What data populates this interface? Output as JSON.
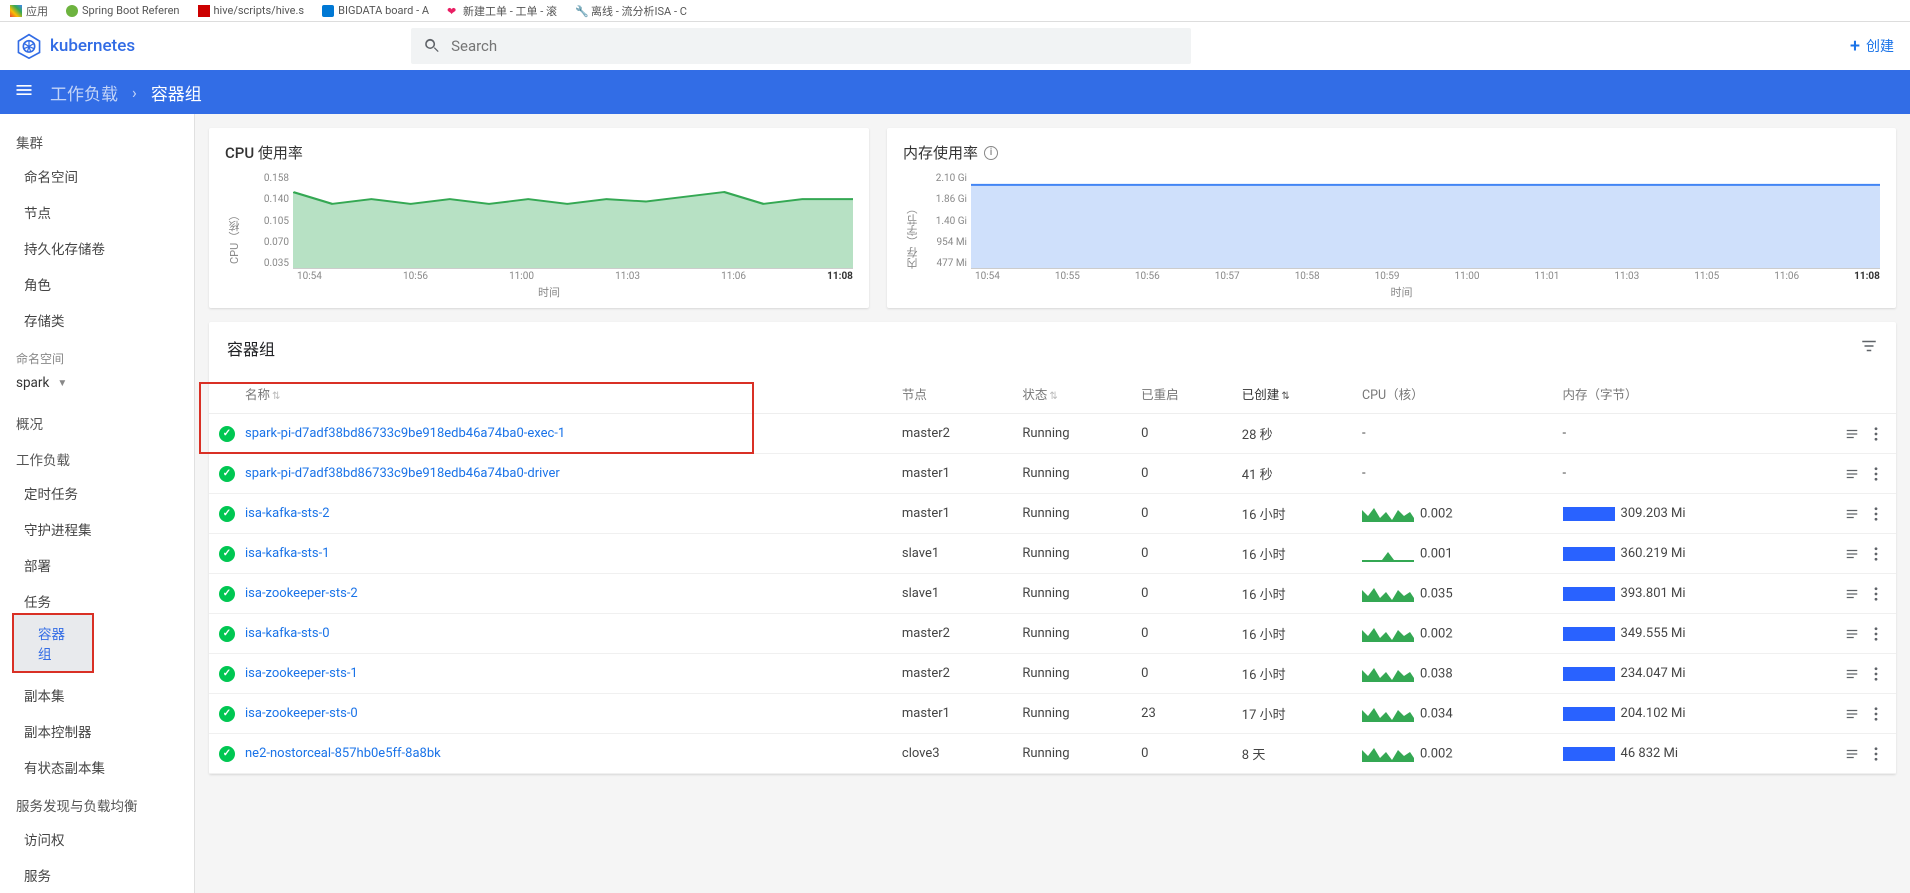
{
  "browser_tabs": [
    {
      "icon": "apps",
      "label": "应用"
    },
    {
      "icon": "spring",
      "label": "Spring Boot Referen"
    },
    {
      "icon": "hive",
      "label": "hive/scripts/hive.s"
    },
    {
      "icon": "az",
      "label": "BIGDATA board - A"
    },
    {
      "icon": "heart",
      "label": "新建工单 - 工单 - 滚"
    },
    {
      "icon": "tool",
      "label": "离线 - 流分析ISA - C"
    }
  ],
  "brand": "kubernetes",
  "search_placeholder": "Search",
  "create_label": "创建",
  "breadcrumb": {
    "a": "工作负载",
    "b": "容器组"
  },
  "sidebar": {
    "group_cluster": "集群",
    "cluster_items": [
      "命名空间",
      "节点",
      "持久化存储卷",
      "角色",
      "存储类"
    ],
    "ns_label": "命名空间",
    "ns_value": "spark",
    "group_overview": "概况",
    "group_workloads": "工作负载",
    "workload_items": [
      "定时任务",
      "守护进程集",
      "部署",
      "任务",
      "容器组",
      "副本集",
      "副本控制器",
      "有状态副本集"
    ],
    "active_workload_index": 4,
    "group_discovery": "服务发现与负载均衡",
    "discovery_items": [
      "访问权",
      "服务"
    ]
  },
  "cpu_card": {
    "title": "CPU 使用率",
    "ylabel": "CPU（核）",
    "xlabel": "时间"
  },
  "mem_card": {
    "title": "内存使用率",
    "ylabel": "内存（字节）",
    "xlabel": "时间"
  },
  "chart_data": [
    {
      "type": "area",
      "title": "CPU 使用率",
      "xlabel": "时间",
      "ylabel": "CPU（核）",
      "ylim": [
        0,
        0.158
      ],
      "yticks": [
        "0.158",
        "0.140",
        "0.105",
        "0.070",
        "0.035"
      ],
      "categories": [
        "10:54",
        "10:56",
        "11:00",
        "11:03",
        "11:06",
        "11:08"
      ],
      "values": [
        0.14,
        0.12,
        0.125,
        0.12,
        0.125,
        0.12,
        0.125,
        0.12,
        0.125,
        0.122,
        0.125,
        0.13,
        0.12,
        0.123,
        0.125
      ],
      "color": "#34a853",
      "fill": "#b7e1c4"
    },
    {
      "type": "area",
      "title": "内存使用率",
      "xlabel": "时间",
      "ylabel": "内存（字节）",
      "ylim": [
        0,
        2.1
      ],
      "yticks": [
        "2.10 Gi",
        "1.86 Gi",
        "1.40 Gi",
        "954 Mi",
        "477 Mi"
      ],
      "categories": [
        "10:54",
        "10:55",
        "10:56",
        "10:57",
        "10:58",
        "10:59",
        "11:00",
        "11:01",
        "11:03",
        "11:05",
        "11:06",
        "11:08"
      ],
      "values": [
        1.86,
        1.86,
        1.86,
        1.86,
        1.86,
        1.86,
        1.86,
        1.86,
        1.86,
        1.86,
        1.86,
        1.86
      ],
      "color": "#4285f4",
      "fill": "#cfe0fb"
    }
  ],
  "table": {
    "title": "容器组",
    "columns": {
      "name": "名称",
      "node": "节点",
      "status": "状态",
      "restarts": "已重启",
      "created": "已创建",
      "cpu": "CPU（核）",
      "mem": "内存（字节）"
    },
    "rows": [
      {
        "name": "spark-pi-d7adf38bd86733c9be918edb46a74ba0-exec-1",
        "node": "master2",
        "status": "Running",
        "restarts": "0",
        "created": "28 秒",
        "cpu": "-",
        "mem": "-",
        "spark": false,
        "membar": false
      },
      {
        "name": "spark-pi-d7adf38bd86733c9be918edb46a74ba0-driver",
        "node": "master1",
        "status": "Running",
        "restarts": "0",
        "created": "41 秒",
        "cpu": "-",
        "mem": "-",
        "spark": false,
        "membar": false
      },
      {
        "name": "isa-kafka-sts-2",
        "node": "master1",
        "status": "Running",
        "restarts": "0",
        "created": "16 小时",
        "cpu": "0.002",
        "mem": "309.203 Mi",
        "spark": true,
        "membar": true
      },
      {
        "name": "isa-kafka-sts-1",
        "node": "slave1",
        "status": "Running",
        "restarts": "0",
        "created": "16 小时",
        "cpu": "0.001",
        "mem": "360.219 Mi",
        "spark": true,
        "membar": true
      },
      {
        "name": "isa-zookeeper-sts-2",
        "node": "slave1",
        "status": "Running",
        "restarts": "0",
        "created": "16 小时",
        "cpu": "0.035",
        "mem": "393.801 Mi",
        "spark": true,
        "membar": true
      },
      {
        "name": "isa-kafka-sts-0",
        "node": "master2",
        "status": "Running",
        "restarts": "0",
        "created": "16 小时",
        "cpu": "0.002",
        "mem": "349.555 Mi",
        "spark": true,
        "membar": true
      },
      {
        "name": "isa-zookeeper-sts-1",
        "node": "master2",
        "status": "Running",
        "restarts": "0",
        "created": "16 小时",
        "cpu": "0.038",
        "mem": "234.047 Mi",
        "spark": true,
        "membar": true
      },
      {
        "name": "isa-zookeeper-sts-0",
        "node": "master1",
        "status": "Running",
        "restarts": "23",
        "created": "17 小时",
        "cpu": "0.034",
        "mem": "204.102 Mi",
        "spark": true,
        "membar": true
      },
      {
        "name": "ne2-nostorceal-857hb0e5ff-8a8bk",
        "node": "clove3",
        "status": "Running",
        "restarts": "0",
        "created": "8 天",
        "cpu": "0.002",
        "mem": "46 832 Mi",
        "spark": true,
        "membar": true
      }
    ]
  }
}
